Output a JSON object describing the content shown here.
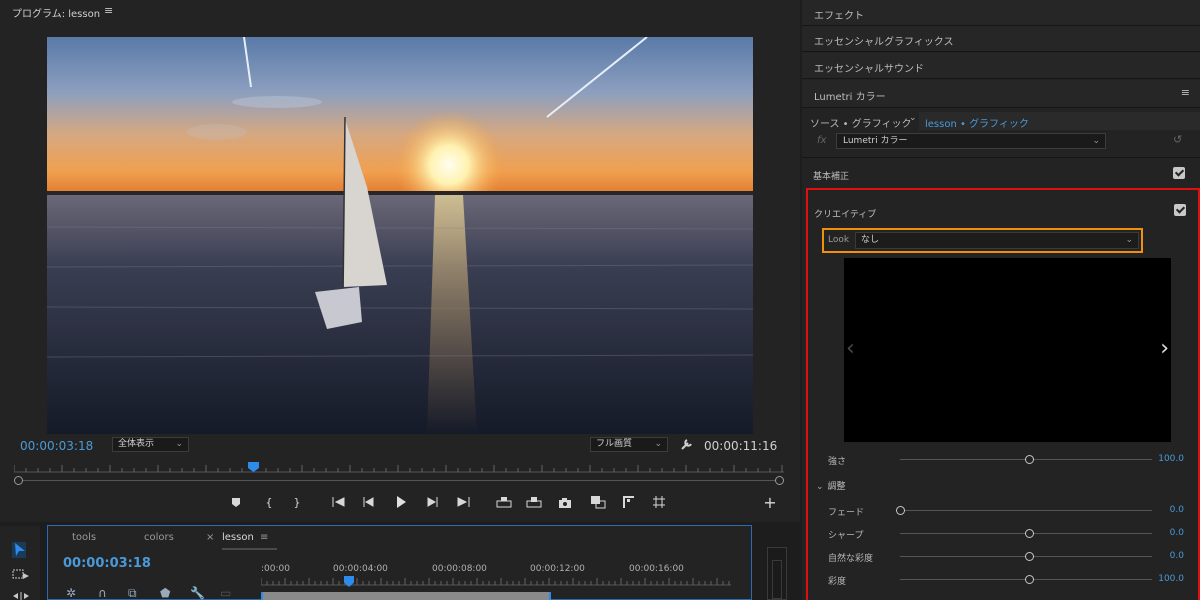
{
  "program": {
    "title": "プログラム: lesson",
    "menu_glyph": "≡",
    "timecode_current": "00:00:03:18",
    "timecode_duration": "00:00:11:16",
    "zoom_value": "全体表示",
    "quality_value": "フル画質"
  },
  "timeline": {
    "tabs": [
      "tools",
      "colors",
      "lesson"
    ],
    "close_glyph": "×",
    "menu_glyph": "≡",
    "timecode": "00:00:03:18",
    "ruler_labels": [
      ":00:00",
      "00:00:04:00",
      "00:00:08:00",
      "00:00:12:00",
      "00:00:16:00"
    ]
  },
  "right_panel": {
    "rows": [
      "エフェクト",
      "エッセンシャルグラフィックス",
      "エッセンシャルサウンド",
      "Lumetri カラー"
    ],
    "menu_glyph": "≡",
    "source_label": "ソース • グラフィック",
    "sequence_label": "lesson • グラフィック",
    "fx_label": "fx",
    "effect_select": "Lumetri カラー",
    "basic_correction": "基本補正",
    "creative": "クリエイティブ",
    "look_label": "Look",
    "look_value": "なし",
    "intensity_label": "強さ",
    "intensity_value": "100.0",
    "adjust_label": "調整",
    "sliders": [
      {
        "label": "フェード",
        "value": "0.0"
      },
      {
        "label": "シャープ",
        "value": "0.0"
      },
      {
        "label": "自然な彩度",
        "value": "0.0"
      },
      {
        "label": "彩度",
        "value": "100.0"
      }
    ]
  },
  "colors": {
    "accent_blue": "#4a9ad8",
    "highlight_red": "#e01010",
    "highlight_orange": "#f0900f"
  }
}
